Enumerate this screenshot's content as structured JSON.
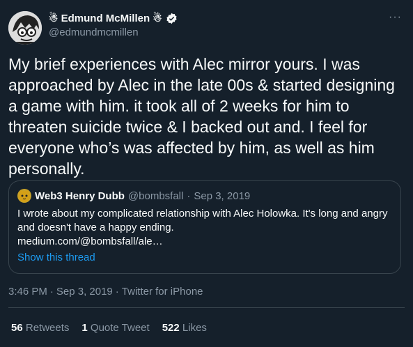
{
  "author": {
    "name": "☃ Edmund McMillen ☃",
    "handle": "@edmundmcmillen"
  },
  "menu_label": "···",
  "tweet_text": "My brief experiences with Alec mirror  yours. I was approached by Alec in the late 00s & started designing a game with him. it took all of 2 weeks for him to threaten suicide twice & I backed out and. I feel for everyone who’s was affected by him, as well as him personally.",
  "quoted_tweet": {
    "name": "Web3 Henry Dubb",
    "handle": "@bombsfall",
    "separator": "·",
    "date": "Sep 3, 2019",
    "text_line1": "I wrote about my complicated relationship with Alec Holowka. It's long and angry",
    "text_line2": "and doesn't have a happy ending.",
    "text_line3": "medium.com/@bombsfall/ale…",
    "show_thread": "Show this thread"
  },
  "meta": {
    "time": "3:46 PM",
    "sep1": "·",
    "date": "Sep 3, 2019",
    "sep2": "·",
    "source": "Twitter for iPhone"
  },
  "stats": {
    "retweets_count": "56",
    "retweets_label": "Retweets",
    "quotes_count": "1",
    "quotes_label": "Quote Tweet",
    "likes_count": "522",
    "likes_label": "Likes"
  },
  "colors": {
    "background": "#15202b",
    "link": "#1d9bf0",
    "secondary": "#8b98a5",
    "border": "#38444d"
  }
}
